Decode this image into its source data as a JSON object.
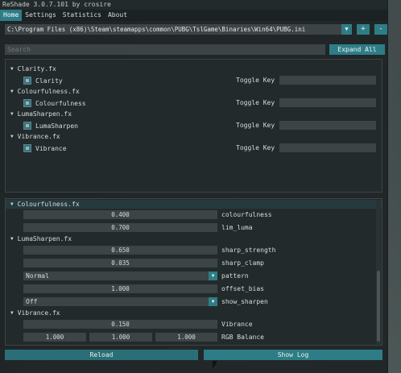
{
  "window": {
    "title": "ReShade 3.0.7.101 by crosire"
  },
  "menu": [
    "Home",
    "Settings",
    "Statistics",
    "About"
  ],
  "path": {
    "value": "C:\\Program Files (x86)\\Steam\\steamapps\\common\\PUBG\\TslGame\\Binaries\\Win64\\PUBG.ini",
    "add": "+",
    "remove": "-"
  },
  "search": {
    "placeholder": "Search",
    "expand": "Expand All"
  },
  "effects": [
    {
      "file": "Clarity.fx",
      "name": "Clarity",
      "toggle": "Toggle Key"
    },
    {
      "file": "Colourfulness.fx",
      "name": "Colourfulness",
      "toggle": "Toggle Key"
    },
    {
      "file": "LumaSharpen.fx",
      "name": "LumaSharpen",
      "toggle": "Toggle Key"
    },
    {
      "file": "Vibrance.fx",
      "name": "Vibrance",
      "toggle": "Toggle Key"
    }
  ],
  "params": {
    "colourfulness_head": "Colourfulness.fx",
    "colourfulness": {
      "value": "0.400",
      "label": "colourfulness"
    },
    "lim_luma": {
      "value": "0.700",
      "label": "lim_luma"
    },
    "lumasharpen_head": "LumaSharpen.fx",
    "sharp_strength": {
      "value": "0.650",
      "label": "sharp_strength"
    },
    "sharp_clamp": {
      "value": "0.035",
      "label": "sharp_clamp"
    },
    "pattern": {
      "value": "Normal",
      "label": "pattern"
    },
    "offset_bias": {
      "value": "1.000",
      "label": "offset_bias"
    },
    "show_sharpen": {
      "value": "Off",
      "label": "show_sharpen"
    },
    "vibrance_head": "Vibrance.fx",
    "vibrance": {
      "value": "0.150",
      "label": "Vibrance"
    },
    "rgb_balance": {
      "values": [
        "1.000",
        "1.000",
        "1.000"
      ],
      "label": "RGB Balance"
    }
  },
  "buttons": {
    "reload": "Reload",
    "show_log": "Show Log"
  },
  "colors": {
    "accent": "#2e7d86",
    "panel": "#232a2c",
    "field": "#3c4446"
  }
}
